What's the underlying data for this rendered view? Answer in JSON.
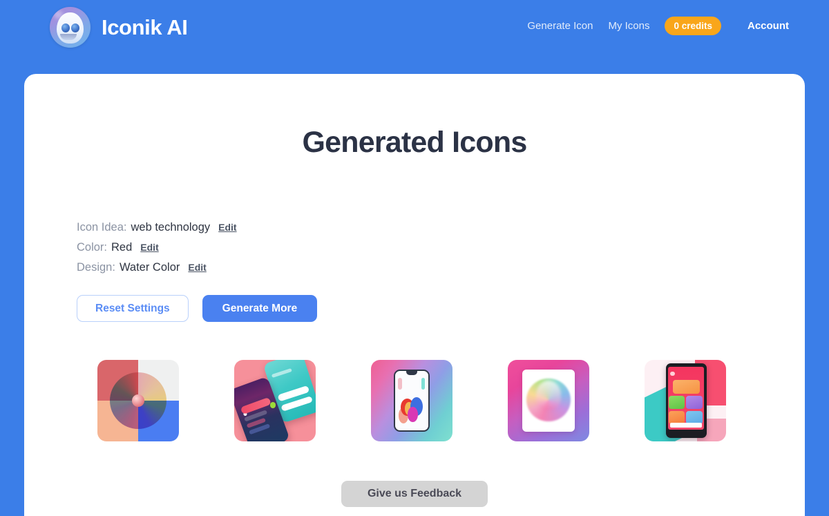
{
  "theme": {
    "page_background": "#3b7ee8",
    "card_background": "#ffffff",
    "primary_button": "#4a81f0",
    "credits_badge": "#f9a61a",
    "title_color": "#2b3245",
    "feedback_button": "#d4d4d4"
  },
  "header": {
    "brand_name": "Iconik AI",
    "logo_icon": "robot-avatar-icon",
    "nav": {
      "generate_icon": "Generate Icon",
      "my_icons": "My Icons",
      "credits": "0 credits",
      "account": "Account"
    }
  },
  "main": {
    "title": "Generated Icons",
    "settings": [
      {
        "label": "Icon Idea:",
        "value": "web technology",
        "edit": "Edit"
      },
      {
        "label": "Color:",
        "value": "Red",
        "edit": "Edit"
      },
      {
        "label": "Design:",
        "value": "Water Color",
        "edit": "Edit"
      }
    ],
    "actions": {
      "reset": "Reset Settings",
      "generate_more": "Generate More"
    },
    "results": [
      {
        "name": "icon-result-1",
        "description": "color wheel on four-quadrant red white peach blue background"
      },
      {
        "name": "icon-result-2",
        "description": "two tilted smartphones purple and teal on pink background"
      },
      {
        "name": "icon-result-3",
        "description": "smartphone with colorful paint blobs on pink to teal gradient"
      },
      {
        "name": "icon-result-4",
        "description": "watercolor rainbow sphere in white frame on magenta purple gradient"
      },
      {
        "name": "icon-result-5",
        "description": "smartphone with colorful app tiles on teal pink white background"
      }
    ],
    "feedback_button": "Give us Feedback"
  }
}
